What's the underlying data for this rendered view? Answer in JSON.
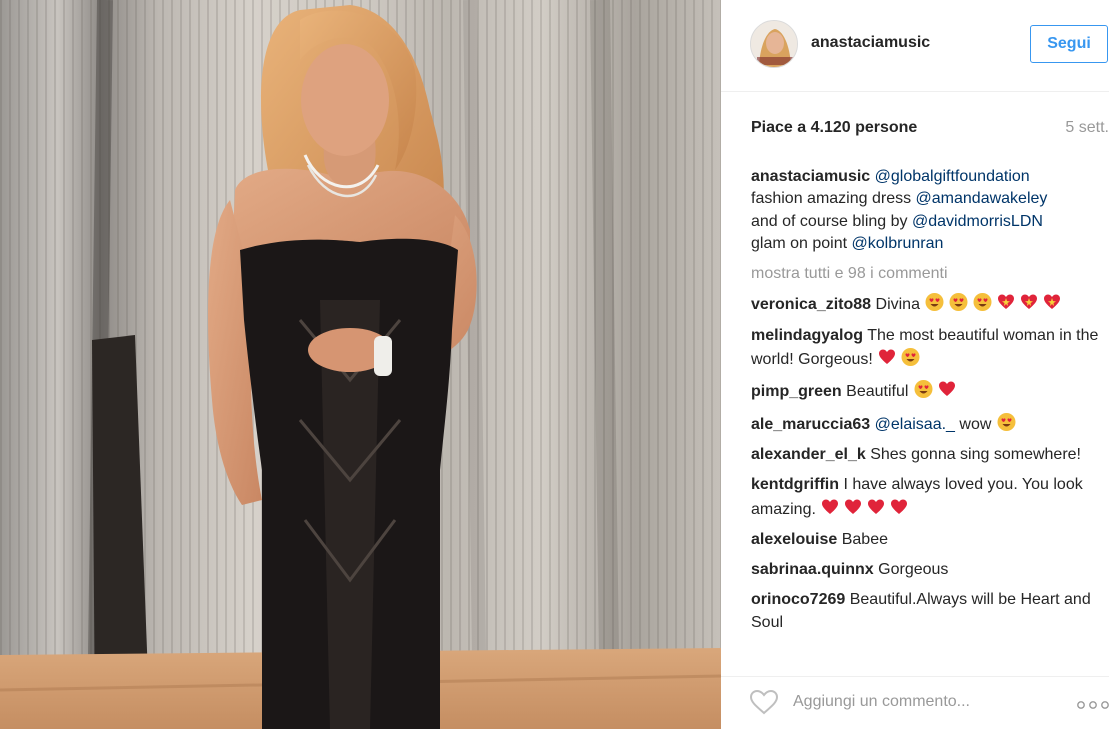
{
  "post": {
    "username": "anastaciamusic",
    "follow_label": "Segui",
    "likes_text": "Piace a 4.120 persone",
    "time_text": "5 sett.",
    "caption": {
      "user": "anastaciamusic",
      "line1_mention": "@globalgiftfoundation",
      "line2_text": "fashion amazing dress ",
      "line2_mention": "@amandawakeley",
      "line3_text": "and of course bling by ",
      "line3_mention": "@davidmorrisLDN",
      "line4_text": "glam on point ",
      "line4_mention": "@kolbrunran"
    },
    "view_all_comments": "mostra tutti e 98 i commenti",
    "comments": [
      {
        "user": "veronica_zito88",
        "text": "Divina"
      },
      {
        "user": "melindagyalog",
        "text": "The most beautiful woman in the world! Gorgeous!"
      },
      {
        "user": "pimp_green",
        "text": "Beautiful"
      },
      {
        "user": "ale_maruccia63",
        "mention": "@elaisaa._",
        "text": "wow"
      },
      {
        "user": "alexander_el_k",
        "text": "Shes gonna sing somewhere!"
      },
      {
        "user": "kentdgriffin",
        "text": "I have always loved you. You look amazing."
      },
      {
        "user": "alexelouise",
        "text": "Babee"
      },
      {
        "user": "sabrinaa.quinnx",
        "text": "Gorgeous"
      },
      {
        "user": "orinoco7269",
        "text": "Beautiful.Always will be Heart and Soul"
      }
    ],
    "add_comment_placeholder": "Aggiungi un commento...",
    "icons": {
      "like": "heart-outline-icon",
      "more": "ellipsis-icon",
      "emoji_heart_eyes": "heart-eyes-emoji",
      "emoji_sparkling_heart": "sparkling-heart-emoji",
      "emoji_red_heart": "red-heart-emoji"
    },
    "colors": {
      "link": "#003569",
      "follow": "#3897f0",
      "muted": "#999999",
      "text": "#262626"
    }
  }
}
